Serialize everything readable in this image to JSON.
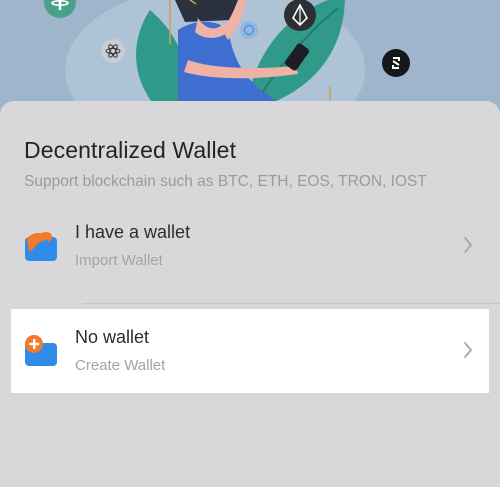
{
  "wallet_sheet": {
    "title": "Decentralized Wallet",
    "subtitle": "Support blockchain such as BTC, ETH, EOS, TRON, IOST",
    "options": [
      {
        "label": "I have a wallet",
        "sublabel": "Import Wallet",
        "icon": "import-wallet-icon",
        "selected": false
      },
      {
        "label": "No wallet",
        "sublabel": "Create Wallet",
        "icon": "create-wallet-icon",
        "selected": true
      }
    ]
  },
  "colors": {
    "accent_blue": "#2f8ce8",
    "accent_orange": "#f27a2a",
    "teal": "#2a9d8f",
    "hero_background": "#9fb5cc"
  }
}
